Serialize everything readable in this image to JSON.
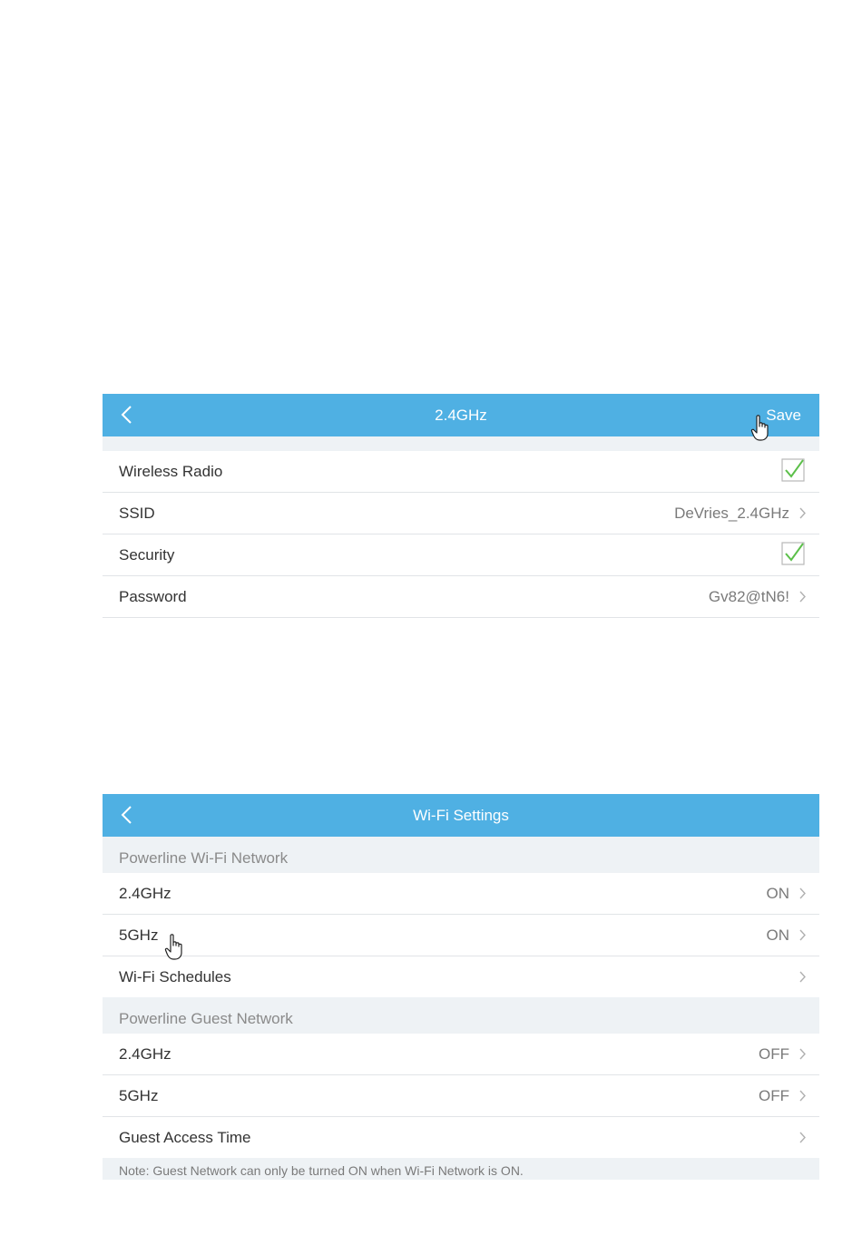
{
  "screen_24ghz": {
    "title": "2.4GHz",
    "save_label": "Save",
    "rows": [
      {
        "label": "Wireless Radio",
        "checked": true
      },
      {
        "label": "SSID",
        "value": "DeVries_2.4GHz"
      },
      {
        "label": "Security",
        "checked": true
      },
      {
        "label": "Password",
        "value": "Gv82@tN6!"
      }
    ]
  },
  "screen_wifi": {
    "title": "Wi-Fi Settings",
    "sections": [
      {
        "header": "Powerline Wi-Fi Network",
        "rows": [
          {
            "label": "2.4GHz",
            "value": "ON"
          },
          {
            "label": "5GHz",
            "value": "ON"
          },
          {
            "label": "Wi-Fi Schedules",
            "value": ""
          }
        ]
      },
      {
        "header": "Powerline Guest Network",
        "rows": [
          {
            "label": "2.4GHz",
            "value": "OFF"
          },
          {
            "label": "5GHz",
            "value": "OFF"
          },
          {
            "label": "Guest Access Time",
            "value": ""
          }
        ]
      }
    ],
    "note": "Note: Guest Network can only be turned ON when Wi-Fi Network is ON."
  },
  "colors": {
    "header_bg": "#4fb0e3",
    "check_green": "#5cc04a",
    "section_bg": "#eef2f5"
  },
  "icons": {
    "back": "chevron-left-icon",
    "disclosure": "chevron-right-icon",
    "checkbox": "checkmark-icon",
    "pointer": "hand-pointer-icon"
  }
}
